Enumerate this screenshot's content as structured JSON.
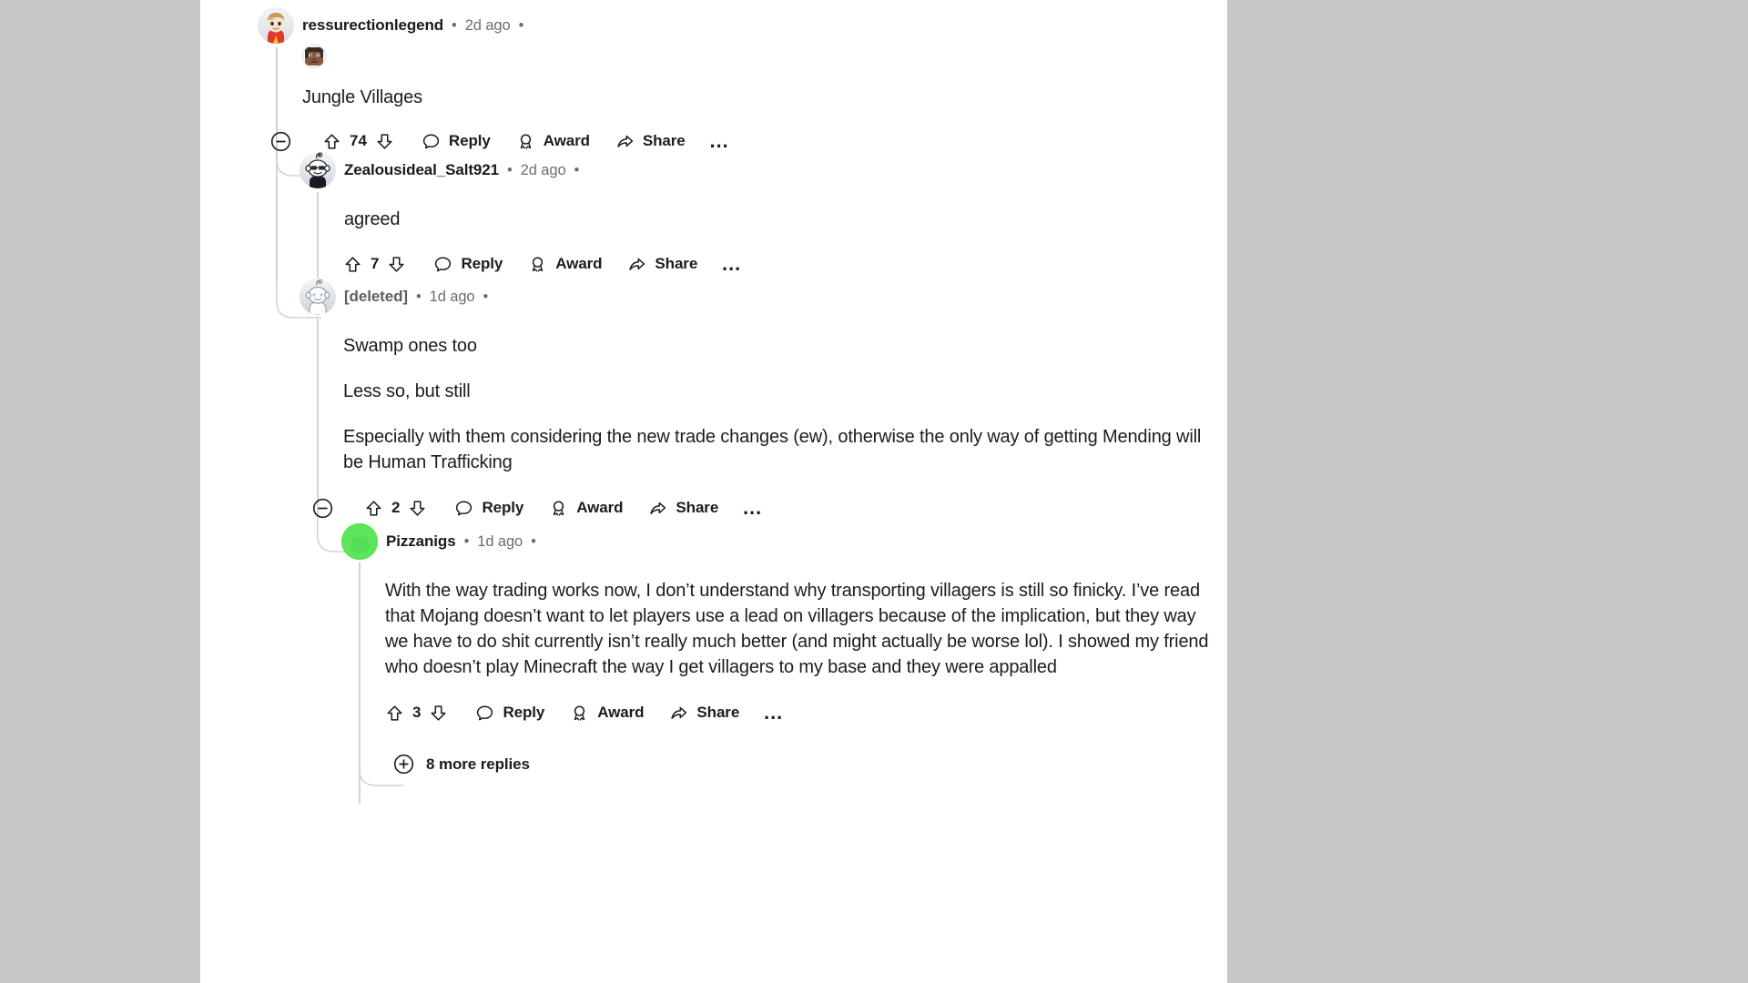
{
  "page": {
    "background_color": "#c8c8c8",
    "pane_color": "#ffffff"
  },
  "thread": {
    "comments": [
      {
        "id": "c1",
        "username": "ressurectionlegend",
        "username_color": "#1a1a1b",
        "separator": "•",
        "timestamp": "2d ago",
        "trailing_separator": "•",
        "has_flair": true,
        "flair_icon": "minecraft-steve-head-icon",
        "avatar_icon": "avatar-boy-red-shirt",
        "body_paragraphs": [
          "Jungle Villages"
        ],
        "has_collapse": true,
        "collapse_icon": "collapse-minus-icon",
        "score": "74",
        "upvote_icon": "upvote-arrow-icon",
        "downvote_icon": "downvote-arrow-icon",
        "reply_label": "Reply",
        "reply_icon": "comment-bubble-icon",
        "award_label": "Award",
        "award_icon": "award-medal-icon",
        "share_label": "Share",
        "share_icon": "share-arrow-icon",
        "overflow_label": "…",
        "overflow_icon": "more-options-icon"
      },
      {
        "id": "c2",
        "username": "Zealousideal_Salt921",
        "username_color": "#1a1a1b",
        "separator": "•",
        "timestamp": "2d ago",
        "trailing_separator": "•",
        "has_flair": false,
        "avatar_icon": "avatar-snoo-glasses-dark-shirt",
        "body_paragraphs": [
          "agreed"
        ],
        "has_collapse": false,
        "score": "7",
        "upvote_icon": "upvote-arrow-icon",
        "downvote_icon": "downvote-arrow-icon",
        "reply_label": "Reply",
        "reply_icon": "comment-bubble-icon",
        "award_label": "Award",
        "award_icon": "award-medal-icon",
        "share_label": "Share",
        "share_icon": "share-arrow-icon",
        "overflow_label": "…",
        "overflow_icon": "more-options-icon"
      },
      {
        "id": "c3",
        "username": "[deleted]",
        "username_color": "#5c6063",
        "separator": "•",
        "timestamp": "1d ago",
        "trailing_separator": "•",
        "has_flair": false,
        "avatar_icon": "avatar-snoo-deleted-gray",
        "body_paragraphs": [
          "Swamp ones too",
          "Less so, but still",
          "Especially with them considering the new trade changes (ew), otherwise the only way of getting Mending will be Human Trafficking"
        ],
        "has_collapse": true,
        "collapse_icon": "collapse-minus-icon",
        "score": "2",
        "upvote_icon": "upvote-arrow-icon",
        "downvote_icon": "downvote-arrow-icon",
        "reply_label": "Reply",
        "reply_icon": "comment-bubble-icon",
        "award_label": "Award",
        "award_icon": "award-medal-icon",
        "share_label": "Share",
        "share_icon": "share-arrow-icon",
        "overflow_label": "…",
        "overflow_icon": "more-options-icon"
      },
      {
        "id": "c4",
        "username": "Pizzanigs",
        "username_color": "#1a1a1b",
        "separator": "•",
        "timestamp": "1d ago",
        "trailing_separator": "•",
        "has_flair": false,
        "avatar_icon": "avatar-green-circle",
        "avatar_color": "#5ce65c",
        "body_paragraphs": [
          "With the way trading works now, I don’t understand why transporting villagers is still so finicky. I’ve read that Mojang doesn’t want to let players use a lead on villagers because of the implication, but they way we have to do shit currently isn’t really much better (and might actually be worse lol). I showed my friend who doesn’t play Minecraft the way I get villagers to my base and they were appalled"
        ],
        "has_collapse": false,
        "score": "3",
        "upvote_icon": "upvote-arrow-icon",
        "downvote_icon": "downvote-arrow-icon",
        "reply_label": "Reply",
        "reply_icon": "comment-bubble-icon",
        "award_label": "Award",
        "award_icon": "award-medal-icon",
        "share_label": "Share",
        "share_icon": "share-arrow-icon",
        "overflow_label": "…",
        "overflow_icon": "more-options-icon"
      }
    ],
    "more_replies": {
      "label": "8 more replies",
      "icon": "expand-plus-icon"
    }
  }
}
